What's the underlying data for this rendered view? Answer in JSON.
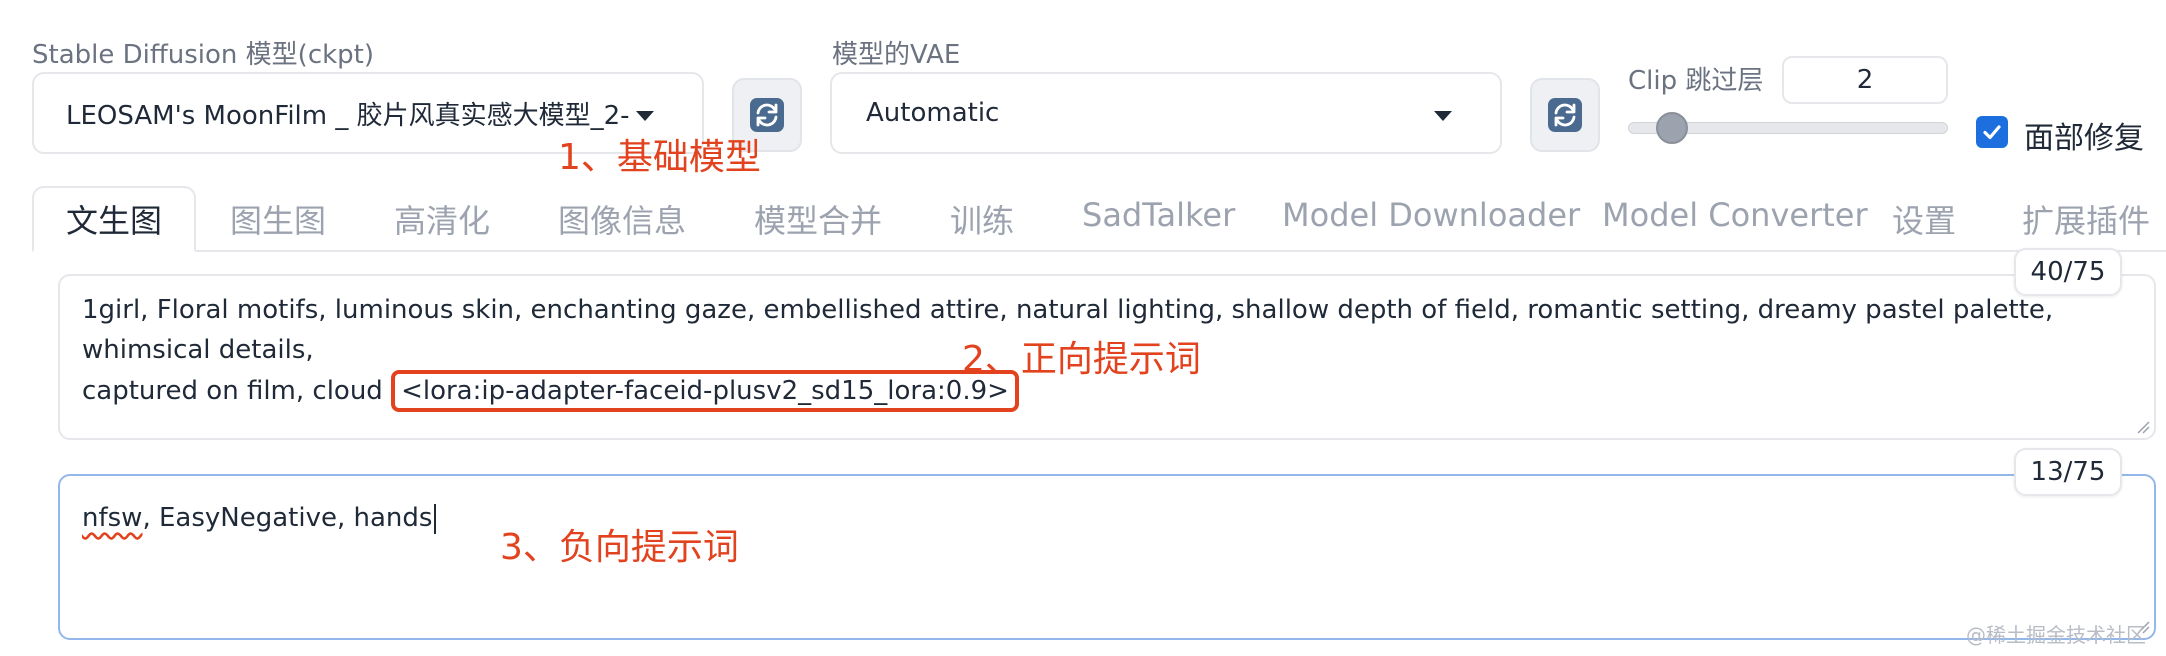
{
  "top": {
    "sd_model_label": "Stable Diffusion 模型(ckpt)",
    "sd_model_value": "LEOSAM's MoonFilm _ 胶片风真实感大模型_2-",
    "vae_label": "模型的VAE",
    "vae_value": "Automatic",
    "clip_label": "Clip 跳过层",
    "clip_value": "2",
    "clip_level": 2,
    "face_restore_label": "面部修复",
    "face_restore_checked": true
  },
  "annotations": {
    "base_model": "1、基础模型",
    "positive_prompt": "2、正向提示词",
    "negative_prompt": "3、负向提示词"
  },
  "tabs": [
    "文生图",
    "图生图",
    "高清化",
    "图像信息",
    "模型合并",
    "训练",
    "SadTalker",
    "Model Downloader",
    "Model Converter",
    "设置",
    "扩展插件"
  ],
  "active_tab": "文生图",
  "prompt": {
    "counter": "40/75",
    "text_line1": "1girl, Floral motifs, luminous skin, enchanting gaze, embellished attire, natural lighting, shallow depth of field, romantic setting, dreamy pastel palette, whimsical details,",
    "text_line2_prefix": "captured on film, cloud ",
    "lora_tag": "<lora:ip-adapter-faceid-plusv2_sd15_lora:0.9>"
  },
  "negative": {
    "counter": "13/75",
    "word_misspelled": "nfsw",
    "text_rest": ", EasyNegative, hands"
  },
  "watermark": "@稀土掘金技术社区",
  "colors": {
    "accent": "#1d6fe0",
    "annotation": "#e2421d"
  }
}
